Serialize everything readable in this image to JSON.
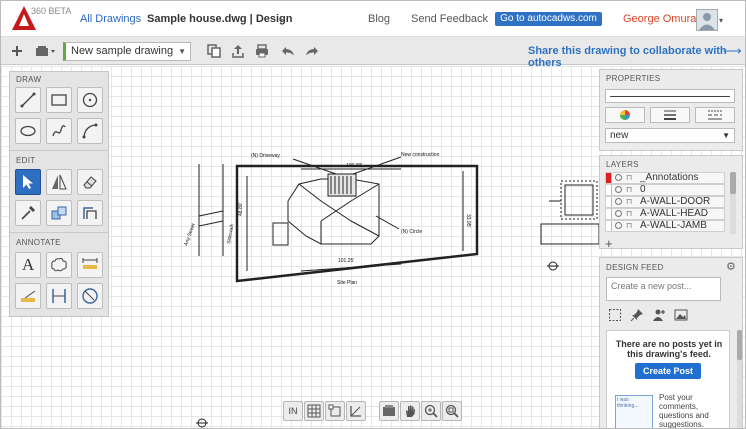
{
  "header": {
    "logo_badge": "360 BETA",
    "nav_all_drawings": "All Drawings",
    "drawing_title": "Sample house.dwg | Design",
    "blog": "Blog",
    "send_feedback": "Send Feedback",
    "goto_button": "Go to autocadws.com",
    "user_name": "George Omura",
    "title_caret": "▾",
    "avatar_caret": "▾"
  },
  "toolbar": {
    "drawing_select_value": "New sample drawing",
    "share_text": "Share this drawing to collaborate with others",
    "share_arrow": "⟶",
    "icons": [
      "plus-icon",
      "layout-icon",
      "copy-icon",
      "upload-icon",
      "print-icon",
      "undo-icon",
      "redo-icon"
    ]
  },
  "palette": {
    "draw_label": "DRAW",
    "edit_label": "EDIT",
    "annotate_label": "ANNOTATE",
    "text_tool_glyph": "A"
  },
  "properties": {
    "title": "PROPERTIES",
    "layer_select_value": "new"
  },
  "layers": {
    "title": "LAYERS",
    "items": [
      {
        "name": "_Annotations",
        "color": "#e02020"
      },
      {
        "name": "0",
        "color": "#ffffff"
      },
      {
        "name": "A-WALL-DOOR",
        "color": "#ffffff"
      },
      {
        "name": "A-WALL-HEAD",
        "color": "#ffffff"
      },
      {
        "name": "A-WALL-JAMB",
        "color": "#ffffff"
      }
    ],
    "add_label": "+"
  },
  "design_feed": {
    "title": "DESIGN FEED",
    "post_placeholder": "Create a new post...",
    "empty_message": "There are no posts yet in this drawing's feed.",
    "create_button": "Create Post",
    "thinking_label": "I was thinking...",
    "tip": "Post your comments, questions and suggestions."
  },
  "drawing": {
    "annotations": {
      "driveway": "(N) Driveway",
      "new_construction": "New construction",
      "top_dim": "100.00'",
      "left_dim": "48.80'",
      "right_dim": "33.95'",
      "bottom_dim": "101.25'",
      "circle": "(N) Circle",
      "street": "Any Street",
      "sidewalk": "Sidewalk",
      "site_plan": "Site Plan"
    }
  },
  "bottom_toolbar": {
    "in_label": "IN"
  }
}
